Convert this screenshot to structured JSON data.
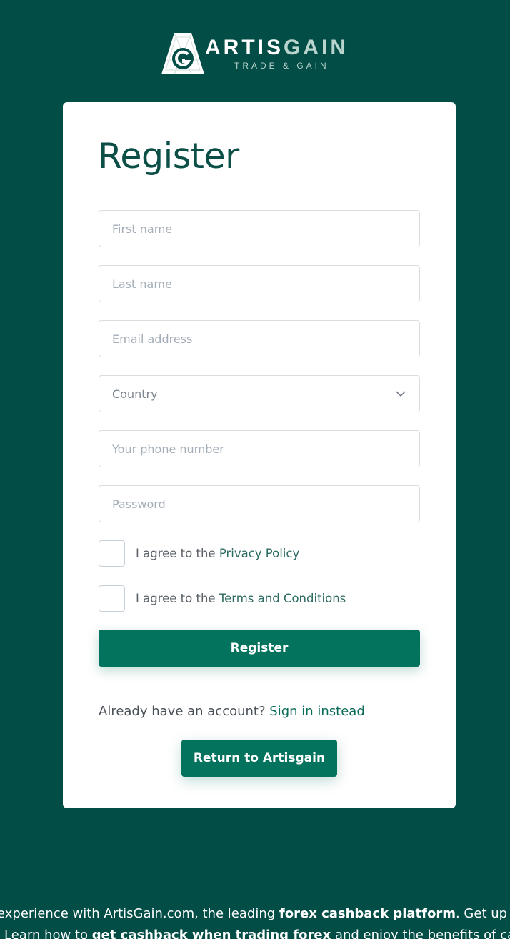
{
  "brand": {
    "word_part1": "ARTIS",
    "word_part2": "GAIN",
    "tagline": "TRADE & GAIN"
  },
  "form": {
    "title": "Register",
    "first_name_placeholder": "First name",
    "last_name_placeholder": "Last name",
    "email_placeholder": "Email address",
    "country_value": "Country",
    "phone_placeholder": "Your phone number",
    "password_placeholder": "Password",
    "privacy_prefix": "I agree to the ",
    "privacy_link": "Privacy Policy",
    "terms_prefix": "I agree to the ",
    "terms_link": "Terms and Conditions",
    "register_label": "Register",
    "signin_prefix": "Already have an account? ",
    "signin_link": "Sign in instead",
    "return_label": "Return to Artisgain"
  },
  "footer": {
    "line1_a": "experience with ArtisGain.com, the leading ",
    "line1_b": "forex cashback platform",
    "line1_c": ". Get up t",
    "line2_a": "Learn how to ",
    "line2_b": "get cashback when trading forex",
    "line2_c": " and enjoy the benefits of cas"
  },
  "colors": {
    "background": "#024d45",
    "accent": "#04735e",
    "link": "#2d6b62"
  }
}
